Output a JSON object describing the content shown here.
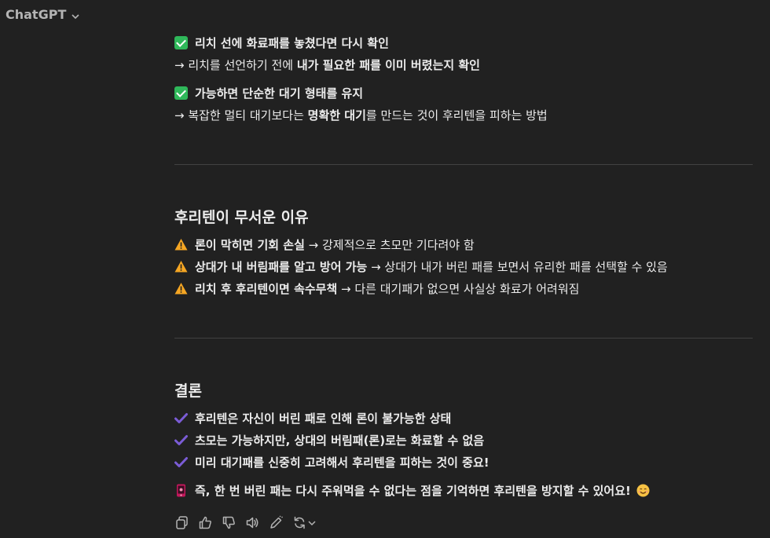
{
  "app": {
    "title": "ChatGPT"
  },
  "message": {
    "l1": {
      "text": "리치 선에 화료패를 놓쳤다면 다시 확인"
    },
    "l2": {
      "a": "→ 리치를 선언하기 전에 ",
      "b": "내가 필요한 패를 이미 버렸는지 확인"
    },
    "l3": {
      "text": "가능하면 단순한 대기 형태를 유지"
    },
    "l4": {
      "a": "→ 복잡한 멀티 대기보다는 ",
      "b": "명확한 대기",
      "c": "를 만드는 것이 후리텐을 피하는 방법"
    },
    "section1": {
      "title": "후리텐이 무서운 이유"
    },
    "w1": {
      "b": "론이 막히면 기회 손실",
      "c": " → 강제적으로 츠모만 기다려야 함"
    },
    "w2": {
      "b": "상대가 내 버림패를 알고 방어 가능",
      "c": " → 상대가 내가 버린 패를 보면서 유리한 패를 선택할 수 있음"
    },
    "w3": {
      "b": "리치 후 후리텐이면 속수무책",
      "c": " → 다른 대기패가 없으면 사실상 화료가 어려워짐"
    },
    "section2": {
      "title": "결론"
    },
    "c1": {
      "text": "후리텐은 자신이 버린 패로 인해 론이 불가능한 상태"
    },
    "c2": {
      "text": "츠모는 가능하지만, 상대의 버림패(론)로는 화료할 수 없음"
    },
    "c3": {
      "text": "미리 대기패를 신중히 고려해서 후리텐을 피하는 것이 중요!"
    },
    "final": {
      "text": "즉, 한 번 버린 패는 다시 주워먹을 수 없다는 점을 기억하면 후리텐을 방지할 수 있어요!"
    }
  },
  "colors": {
    "background": "#212121",
    "text": "#ececec",
    "check_green": "#2fb85a",
    "warning": "#f5a623",
    "tick_purple": "#7b5cd6",
    "divider": "#424242"
  },
  "icons": [
    "white-check-mark-icon",
    "warning-icon",
    "heavy-check-icon",
    "mobile-phone-icon",
    "smile-emoji-icon",
    "copy-icon",
    "thumbs-up-icon",
    "thumbs-down-icon",
    "read-aloud-icon",
    "edit-icon",
    "regenerate-icon"
  ]
}
